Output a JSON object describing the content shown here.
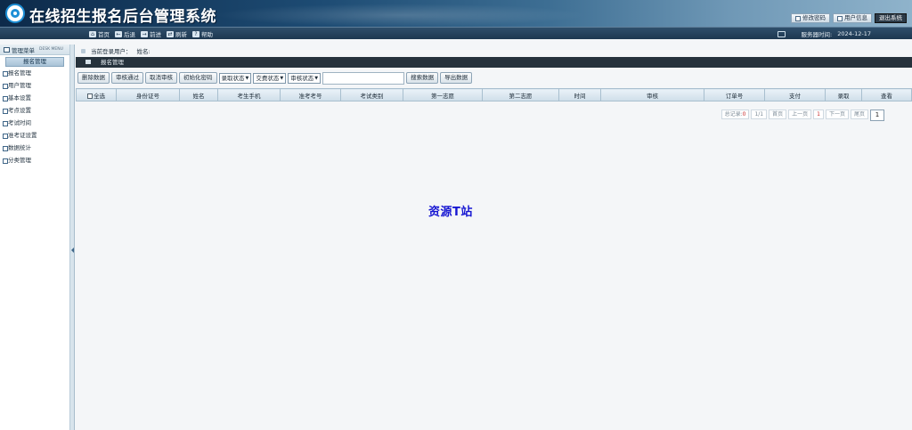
{
  "header": {
    "title": "在线招生报名后台管理系统",
    "links": [
      "修改密码",
      "用户信息",
      "退出系统"
    ]
  },
  "nav": {
    "items": [
      "首页",
      "后退",
      "前进",
      "刷新",
      "帮助"
    ],
    "server_time_label": "服务器时间:",
    "server_time": "2024-12-17"
  },
  "sidebar": {
    "title": "管理菜单",
    "subtitle": "DESK MENU",
    "section": "报名管理",
    "items": [
      "报名管理",
      "用户管理",
      "基本设置",
      "考点设置",
      "考试时间",
      "准考证设置",
      "数据统计",
      "分类管理"
    ]
  },
  "main": {
    "login_user_label": "当前登录用户：",
    "name_label": "姓名:",
    "panel_title": "报名管理",
    "toolbar": {
      "delete": "删除数据",
      "approve": "审核通过",
      "cancel_approve": "取消审核",
      "init_password": "初始化密码",
      "admit_status": "录取状态",
      "fee_status": "交费状态",
      "review_status": "审核状态",
      "search": "搜索数据",
      "export": "导出数据"
    },
    "table_headers": [
      "全选",
      "身份证号",
      "姓名",
      "考生手机",
      "准考考号",
      "考试类别",
      "第一志愿",
      "第二志愿",
      "时间",
      "审核",
      "订单号",
      "支付",
      "录取",
      "查看"
    ],
    "pager": {
      "total_label": "总记录:",
      "total": "0",
      "pages": "1/1",
      "first": "首页",
      "prev": "上一页",
      "current": "1",
      "next": "下一页",
      "last": "尾页",
      "input": "1"
    }
  },
  "watermark": "资源T站"
}
